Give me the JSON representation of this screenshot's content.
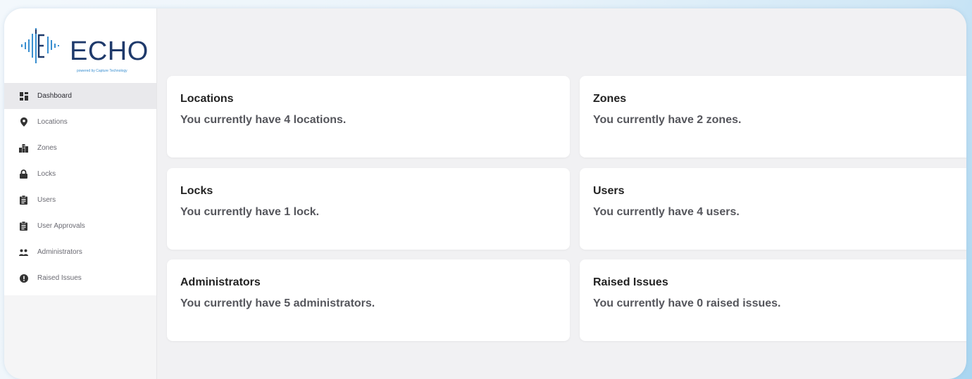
{
  "brand": {
    "name": "ECHO",
    "tagline": "powered by Capture Technology",
    "color": "#1f3a6b",
    "accent": "#3a8fd0"
  },
  "sidebar": {
    "items": [
      {
        "label": "Dashboard",
        "icon": "dashboard-icon",
        "active": true
      },
      {
        "label": "Locations",
        "icon": "map-pin-icon",
        "active": false
      },
      {
        "label": "Zones",
        "icon": "buildings-icon",
        "active": false
      },
      {
        "label": "Locks",
        "icon": "lock-icon",
        "active": false
      },
      {
        "label": "Users",
        "icon": "clipboard-icon",
        "active": false
      },
      {
        "label": "User Approvals",
        "icon": "clipboard-icon",
        "active": false
      },
      {
        "label": "Administrators",
        "icon": "people-icon",
        "active": false
      },
      {
        "label": "Raised Issues",
        "icon": "alert-icon",
        "active": false
      }
    ]
  },
  "cards": [
    {
      "title": "Locations",
      "text": "You currently have 4 locations."
    },
    {
      "title": "Zones",
      "text": "You currently have 2 zones."
    },
    {
      "title": "Locks",
      "text": "You currently have 1 lock."
    },
    {
      "title": "Users",
      "text": "You currently have 4 users."
    },
    {
      "title": "Administrators",
      "text": "You currently have 5 administrators."
    },
    {
      "title": "Raised Issues",
      "text": "You currently have 0 raised issues."
    }
  ]
}
